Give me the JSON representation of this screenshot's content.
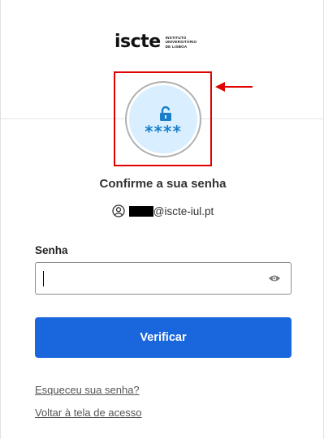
{
  "logo": {
    "word": "iscte",
    "sub_lines": [
      "INSTITUTO",
      "UNIVERSITÁRIO",
      "DE LISBOA"
    ]
  },
  "avatar": {
    "icon": "unlock-icon",
    "masked_text": "****",
    "accent": "#1a7fc8",
    "bg": "#d9efff"
  },
  "highlight": {
    "color": "#e00000"
  },
  "title": "Confirme a sua senha",
  "user": {
    "icon": "user-circle-icon",
    "email_domain": "@iscte-iul.pt"
  },
  "password": {
    "label": "Senha",
    "value": "",
    "toggle_icon": "eye-icon"
  },
  "verify_button": {
    "label": "Verificar",
    "color": "#1a66dd"
  },
  "links": {
    "forgot": "Esqueceu sua senha?",
    "back": "Voltar à tela de acesso"
  }
}
